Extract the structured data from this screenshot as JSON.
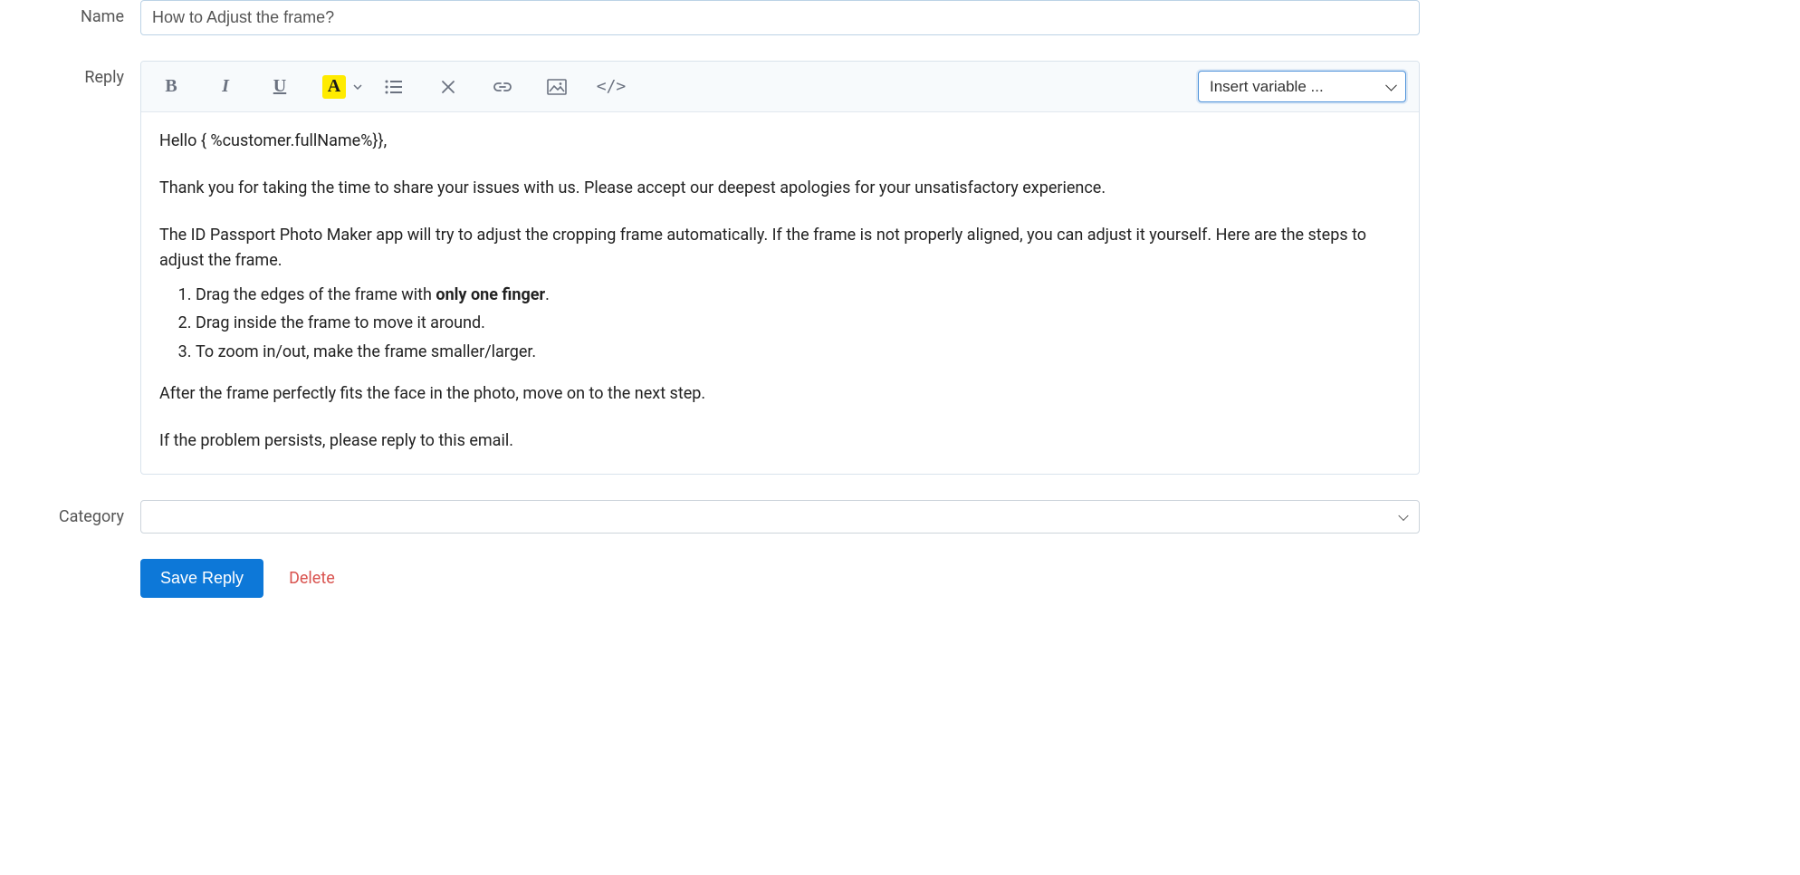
{
  "labels": {
    "name": "Name",
    "reply": "Reply",
    "category": "Category"
  },
  "name_value": "How to Adjust the frame?",
  "toolbar": {
    "bold": "B",
    "italic": "I",
    "underline": "U",
    "color": "A",
    "variable_placeholder": "Insert variable ..."
  },
  "reply_body": {
    "greeting": "Hello { %customer.fullName%}},",
    "intro": "Thank you for taking the time to share your issues with us. Please accept our deepest apologies for your unsatisfactory experience.",
    "explain": "The ID Passport Photo Maker app will try to adjust the cropping frame automatically. If the frame is not properly aligned, you can adjust it yourself. Here are the steps to adjust the frame.",
    "step1_pre": "Drag the edges of the frame with ",
    "step1_bold": "only one finger",
    "step1_post": ".",
    "step2": "Drag inside the frame to move it around.",
    "step3": "To zoom in/out, make the frame smaller/larger.",
    "after": "After the frame perfectly fits the face in the photo, move on to the next step.",
    "closing": "If the problem persists, please reply to this email."
  },
  "category_value": "",
  "actions": {
    "save": "Save Reply",
    "delete": "Delete"
  }
}
